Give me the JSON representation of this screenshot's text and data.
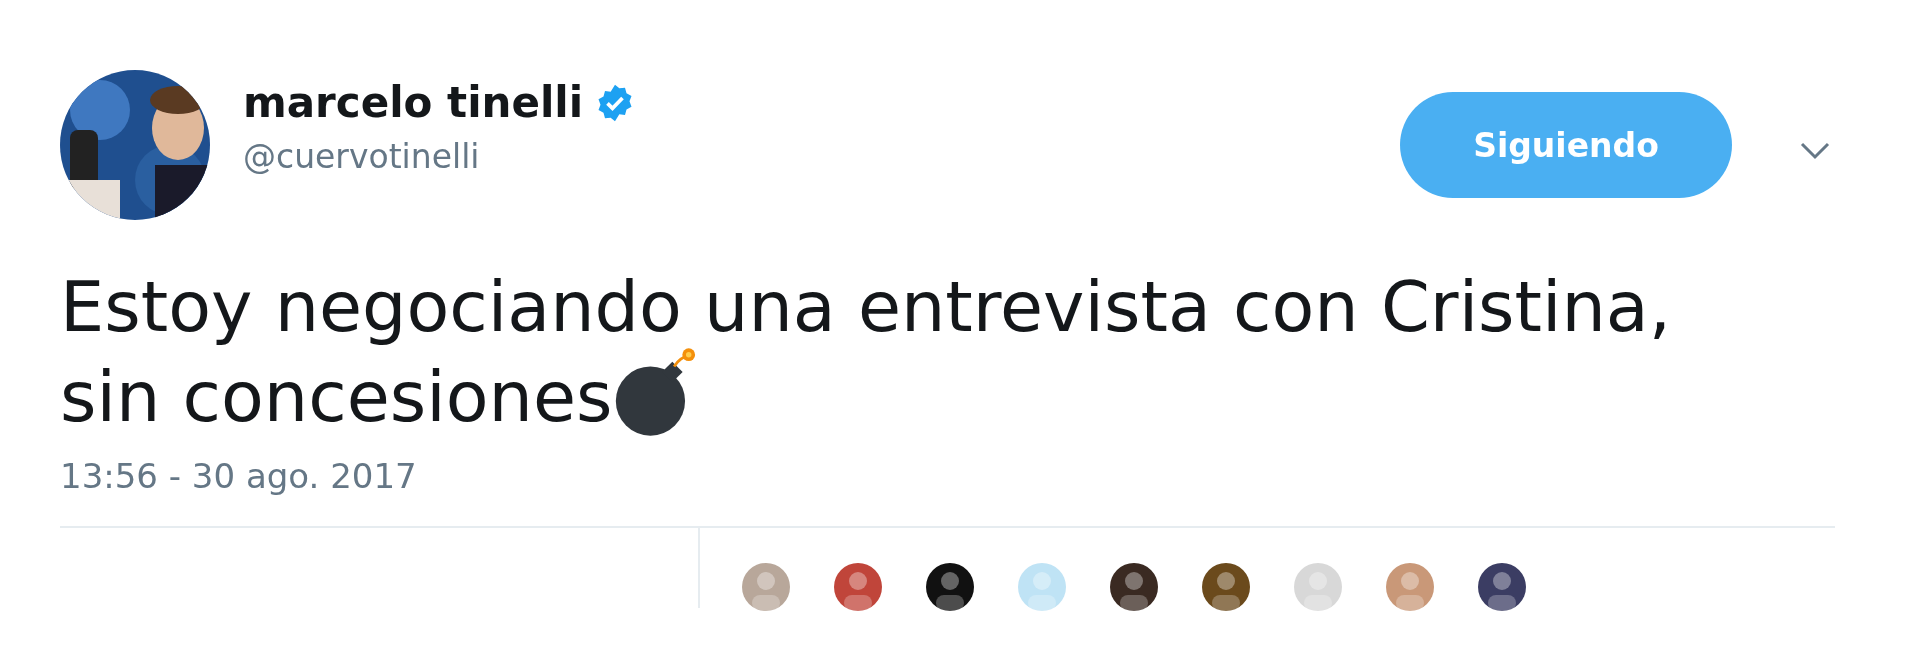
{
  "author": {
    "name": "marcelo tinelli",
    "verified": true,
    "handle": "@cuervotinelli"
  },
  "follow_button": {
    "label": "Siguiendo"
  },
  "tweet": {
    "lines": [
      "Estoy negociando una entrevista con Cristina,",
      "sin concesiones"
    ]
  },
  "timestamp": "13:56 - 30 ago. 2017"
}
